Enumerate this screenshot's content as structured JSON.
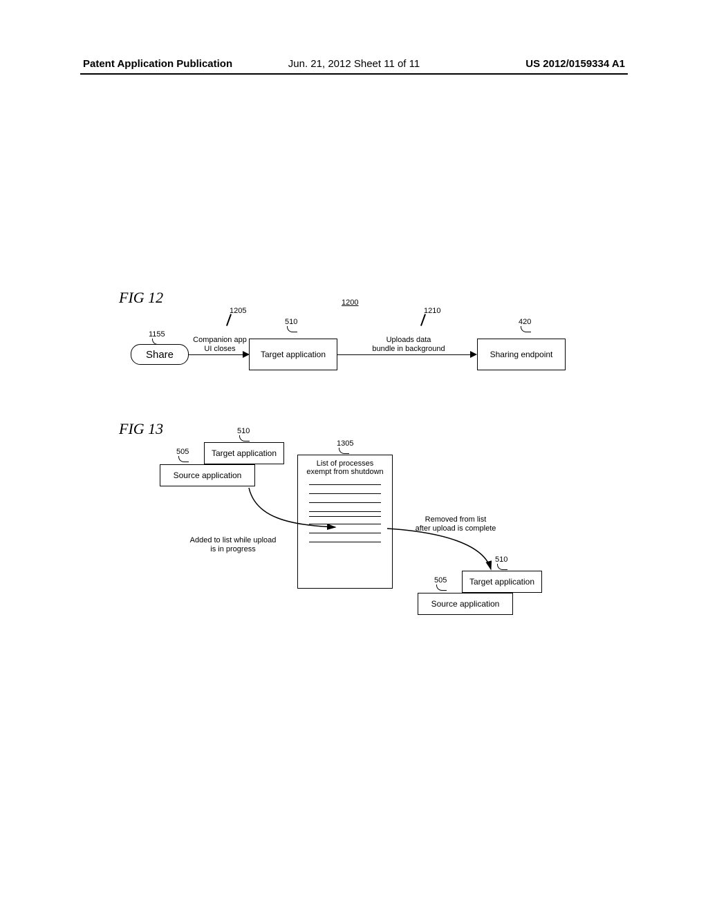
{
  "header": {
    "left": "Patent Application Publication",
    "mid": "Jun. 21, 2012   Sheet 11 of 11",
    "right": "US 2012/0159334 A1"
  },
  "fig12": {
    "title": "FIG 12",
    "main_ref": "1200",
    "share": {
      "label": "Share",
      "ref": "1155"
    },
    "arrow1": {
      "label_line1": "Companion app",
      "label_line2": "UI closes",
      "ref": "1205"
    },
    "target": {
      "label": "Target application",
      "ref": "510"
    },
    "arrow2": {
      "label_line1": "Uploads data",
      "label_line2": "bundle in background",
      "ref": "1210"
    },
    "endpoint": {
      "label": "Sharing endpoint",
      "ref": "420"
    }
  },
  "fig13": {
    "title": "FIG 13",
    "left_stack": {
      "source": {
        "label": "Source application",
        "ref": "505"
      },
      "target": {
        "label": "Target application",
        "ref": "510"
      }
    },
    "list_box": {
      "title_line1": "List of processes",
      "title_line2": "exempt from shutdown",
      "ref": "1305"
    },
    "arrow_in_label_line1": "Added to list while upload",
    "arrow_in_label_line2": "is in progress",
    "arrow_out_label_line1": "Removed from list",
    "arrow_out_label_line2": "after upload is complete",
    "right_stack": {
      "source": {
        "label": "Source application",
        "ref": "505"
      },
      "target": {
        "label": "Target application",
        "ref": "510"
      }
    }
  }
}
